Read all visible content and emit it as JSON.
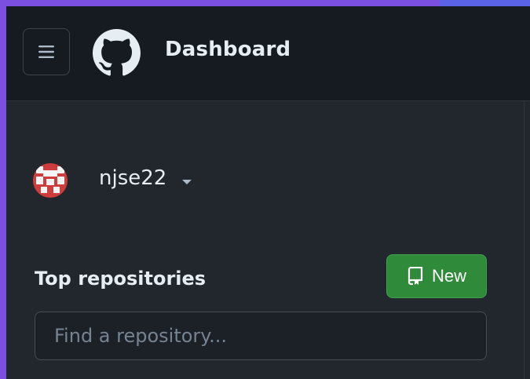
{
  "header": {
    "title": "Dashboard",
    "menu_icon": "hamburger-icon",
    "logo_icon": "github-logo-icon"
  },
  "account": {
    "username": "njse22",
    "avatar_icon": "identicon-avatar"
  },
  "repositories": {
    "heading": "Top repositories",
    "new_button_label": "New",
    "new_button_icon": "repo-icon",
    "search_placeholder": "Find a repository..."
  },
  "colors": {
    "header_bg": "#161b22",
    "sidebar_bg": "#22272e",
    "button_green": "#2f8a3a",
    "avatar_red": "#cf3c3c",
    "frame_purple": "#7b4fe0"
  }
}
